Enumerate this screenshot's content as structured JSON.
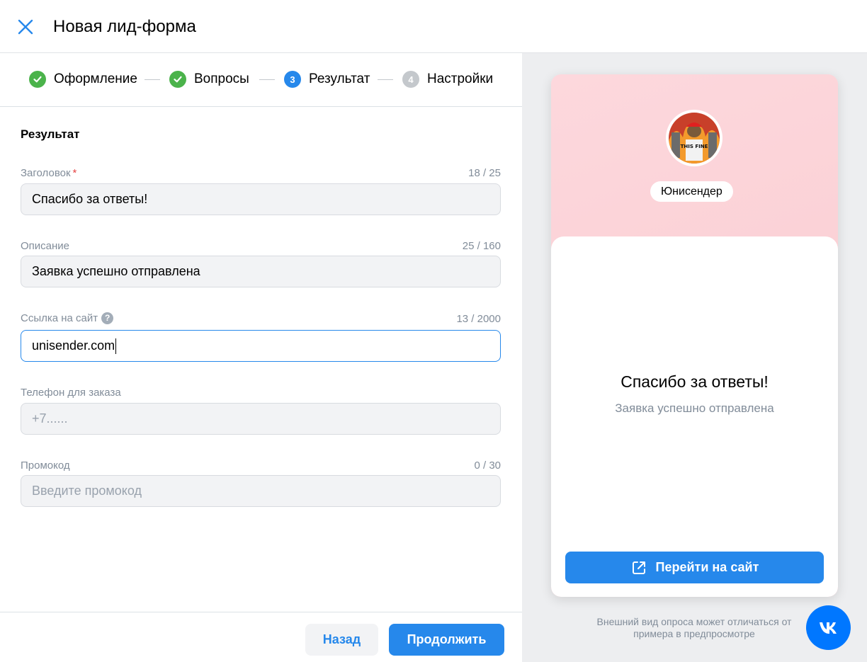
{
  "header": {
    "title": "Новая лид-форма",
    "close_icon": "close-icon"
  },
  "steps": [
    {
      "label": "Оформление",
      "state": "done",
      "number": ""
    },
    {
      "label": "Вопросы",
      "state": "done",
      "number": ""
    },
    {
      "label": "Результат",
      "state": "active",
      "number": "3"
    },
    {
      "label": "Настройки",
      "state": "todo",
      "number": "4"
    }
  ],
  "section": {
    "title": "Результат"
  },
  "fields": {
    "title": {
      "label": "Заголовок",
      "required_mark": "*",
      "counter": "18 / 25",
      "value": "Спасибо за ответы!"
    },
    "description": {
      "label": "Описание",
      "counter": "25 / 160",
      "value": "Заявка успешно отправлена"
    },
    "link": {
      "label": "Ссылка на сайт",
      "help": "?",
      "counter": "13 / 2000",
      "value": "unisender.com"
    },
    "phone": {
      "label": "Телефон для заказа",
      "placeholder": "+7......"
    },
    "promo": {
      "label": "Промокод",
      "counter": "0 / 30",
      "placeholder": "Введите промокод"
    }
  },
  "footer": {
    "back_label": "Назад",
    "next_label": "Продолжить"
  },
  "preview": {
    "brand_name": "Юнисендер",
    "avatar_text": "THIS FINE",
    "card_title": "Спасибо за ответы!",
    "card_description": "Заявка успешно отправлена",
    "site_button_label": "Перейти на сайт",
    "disclaimer": "Внешний вид опроса может отличаться от примера в предпросмотре"
  },
  "colors": {
    "accent": "#2688eb",
    "success": "#4bb34b",
    "required": "#e64646",
    "vk": "#0077ff"
  }
}
